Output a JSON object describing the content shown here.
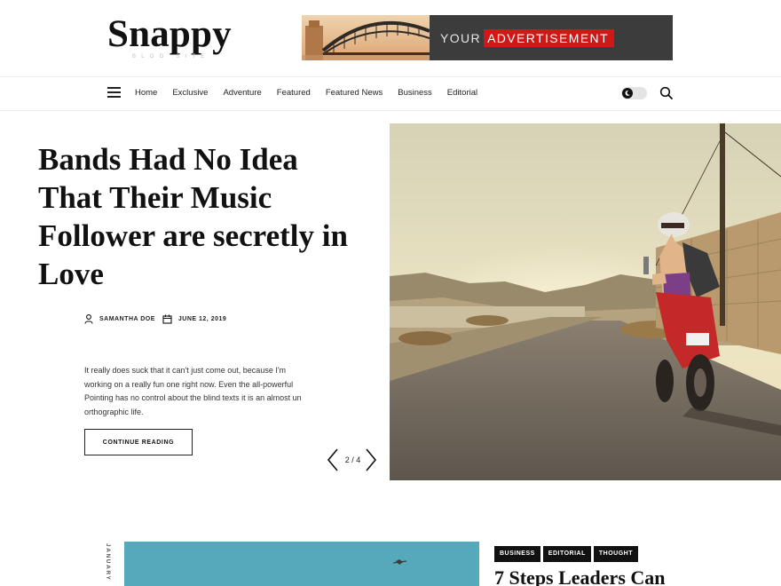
{
  "site": {
    "logo": "Snappy",
    "tagline": "BLOG SITE"
  },
  "ad": {
    "your": "YOUR",
    "advertisement": "ADVERTISEMENT"
  },
  "nav": {
    "items": [
      "Home",
      "Exclusive",
      "Adventure",
      "Featured",
      "Featured News",
      "Business",
      "Editorial"
    ]
  },
  "hero": {
    "title": "Bands Had No Idea That Their Music Follower are secretly in Love",
    "author": "SAMANTHA DOE",
    "date": "JUNE 12, 2019",
    "excerpt": "It really does suck that it can't just come out, because I'm working on a really fun one right now. Even the all-powerful Pointing has no control about the blind texts it is an almost un orthographic life.",
    "button": "CONTINUE READING",
    "slide_counter": "2 / 4"
  },
  "second_article": {
    "date_month": "JANUARY",
    "tags": [
      "BUSINESS",
      "EDITORIAL",
      "THOUGHT"
    ],
    "title": "7 Steps Leaders Can"
  },
  "colors": {
    "ad_accent": "#d01818",
    "ad_background": "#3c3c3c",
    "tag_background": "#111111"
  }
}
